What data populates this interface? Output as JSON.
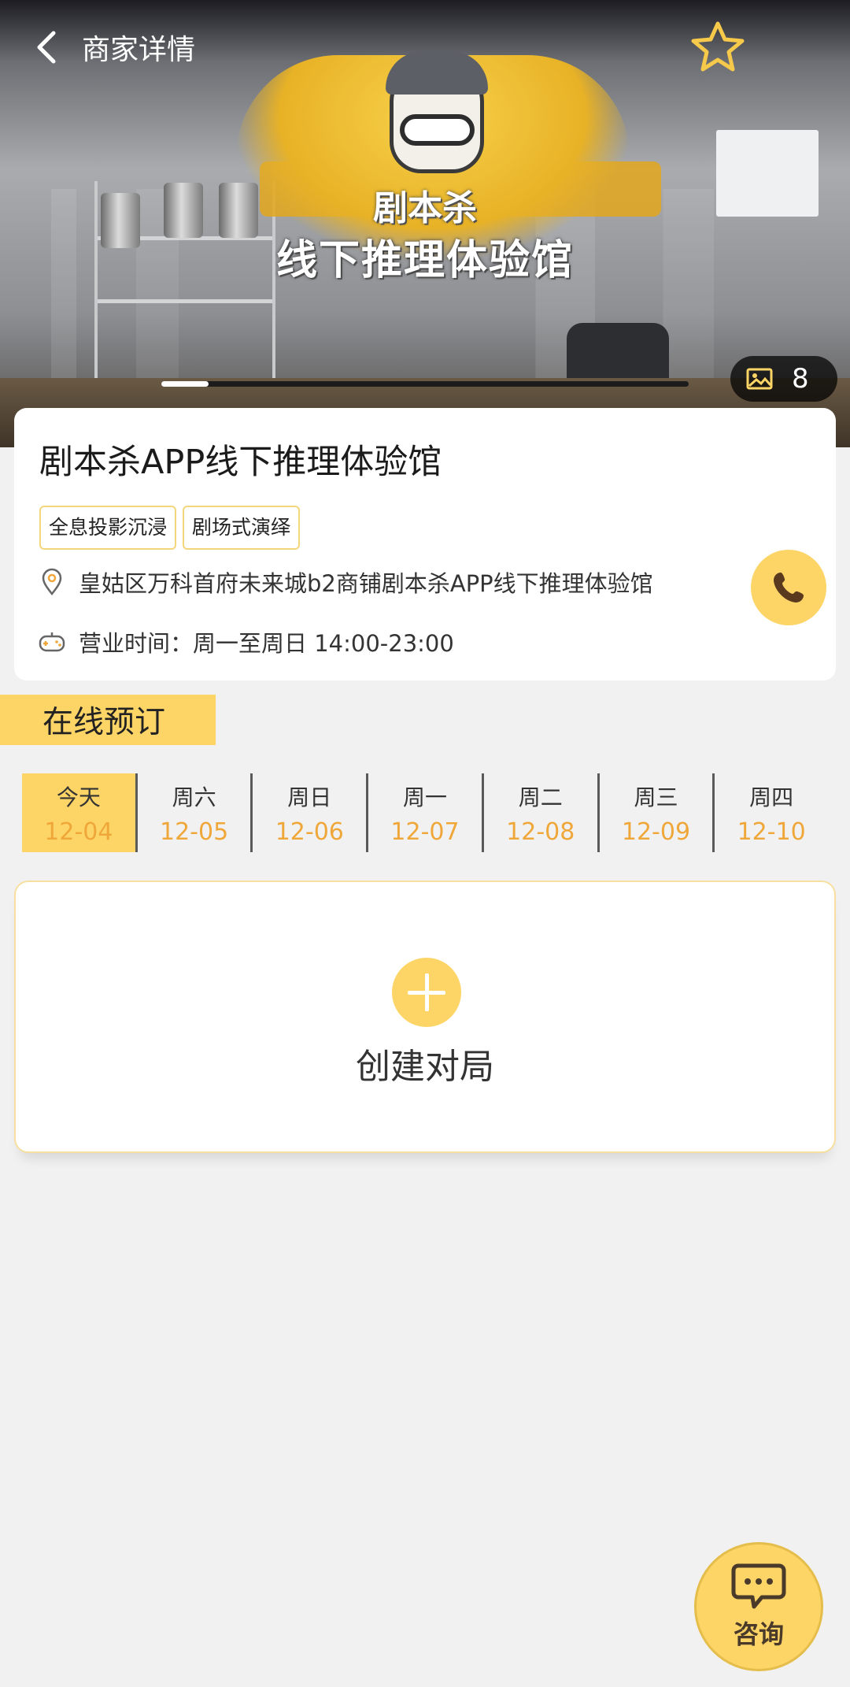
{
  "nav": {
    "title": "商家详情"
  },
  "hero": {
    "sign_line_1": "剧本杀",
    "sign_line_2": "线下推理体验馆",
    "photo_count": "8",
    "slider_progress": 0.09
  },
  "store": {
    "name": "剧本杀APP线下推理体验馆",
    "tags": [
      "全息投影沉浸",
      "剧场式演绎"
    ],
    "address": "皇姑区万科首府未来城b2商铺剧本杀APP线下推理体验馆",
    "hours": "营业时间：周一至周日 14:00-23:00"
  },
  "booking": {
    "section_title": "在线预订",
    "dates": [
      {
        "weekday": "今天",
        "date": "12-04",
        "active": true
      },
      {
        "weekday": "周六",
        "date": "12-05",
        "active": false
      },
      {
        "weekday": "周日",
        "date": "12-06",
        "active": false
      },
      {
        "weekday": "周一",
        "date": "12-07",
        "active": false
      },
      {
        "weekday": "周二",
        "date": "12-08",
        "active": false
      },
      {
        "weekday": "周三",
        "date": "12-09",
        "active": false
      },
      {
        "weekday": "周四",
        "date": "12-10",
        "active": false
      }
    ],
    "create_label": "创建对局"
  },
  "consult": {
    "label": "咨询"
  },
  "colors": {
    "accent": "#fdd466",
    "date_text": "#f0a73a",
    "background": "#f1f1f1"
  },
  "icons": [
    "back-arrow-icon",
    "star-icon",
    "image-icon",
    "location-pin-icon",
    "gamepad-icon",
    "phone-icon",
    "plus-icon",
    "chat-bubble-icon"
  ]
}
